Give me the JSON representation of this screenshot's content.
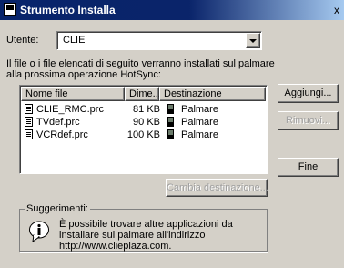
{
  "window": {
    "title": "Strumento Installa",
    "close_label": "x"
  },
  "user": {
    "label": "Utente:",
    "selected": "CLIE"
  },
  "description": "Il file o i file elencati di seguito verranno installati sul palmare alla prossima operazione HotSync:",
  "file_list": {
    "columns": [
      "Nome file",
      "Dime...",
      "Destinazione"
    ],
    "rows": [
      {
        "name": "CLIE_RMC.prc",
        "size": "81 KB",
        "destination": "Palmare"
      },
      {
        "name": "TVdef.prc",
        "size": "90 KB",
        "destination": "Palmare"
      },
      {
        "name": "VCRdef.prc",
        "size": "100 KB",
        "destination": "Palmare"
      }
    ]
  },
  "buttons": {
    "add": "Aggiungi...",
    "remove": "Rimuovi...",
    "end": "Fine",
    "change_destination": "Cambia destinazione..."
  },
  "tips": {
    "legend": "Suggerimenti:",
    "text": "È possibile trovare altre applicazioni da installare sul palmare all'indirizzo http://www.clieplaza.com."
  },
  "colors": {
    "face": "#d4d0c8",
    "title_gradient_start": "#0a246a",
    "title_gradient_end": "#a6caf0",
    "disabled_text": "#a0a0a0"
  }
}
